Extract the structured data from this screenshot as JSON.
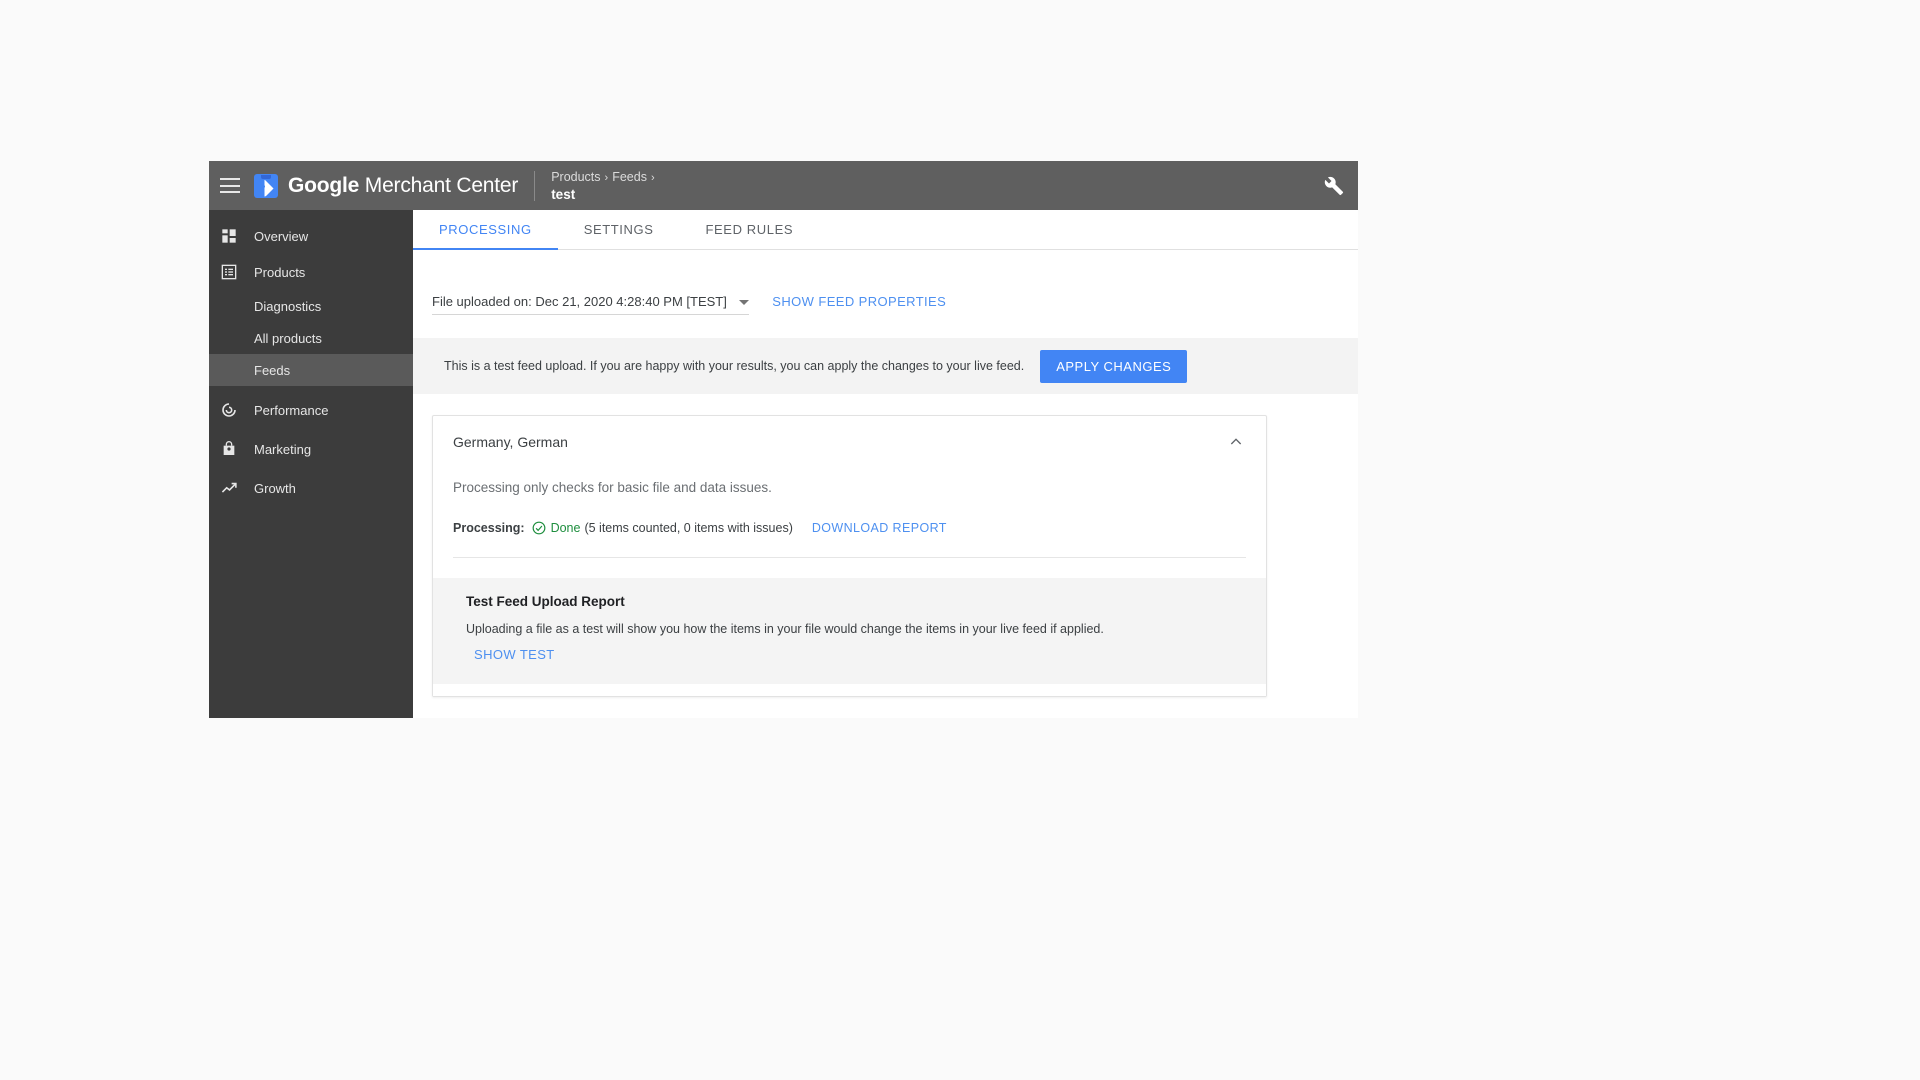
{
  "app": {
    "brand_bold": "Google",
    "brand_light": " Merchant Center",
    "logo_icon": "merchant-tag-icon",
    "menu_icon": "hamburger-menu-icon",
    "tools_icon": "wrench-icon"
  },
  "breadcrumb": {
    "items": [
      "Products",
      "Feeds"
    ],
    "separator": "›",
    "current": "test"
  },
  "sidebar": {
    "items": [
      {
        "label": "Overview",
        "icon": "dashboard-icon",
        "type": "top",
        "active": false
      },
      {
        "label": "Products",
        "icon": "products-list-icon",
        "type": "top",
        "active": false
      },
      {
        "label": "Diagnostics",
        "icon": "",
        "type": "sub",
        "active": false
      },
      {
        "label": "All products",
        "icon": "",
        "type": "sub",
        "active": false
      },
      {
        "label": "Feeds",
        "icon": "",
        "type": "sub",
        "active": true
      },
      {
        "label": "Performance",
        "icon": "performance-circle-icon",
        "type": "top",
        "active": false
      },
      {
        "label": "Marketing",
        "icon": "shopping-bag-icon",
        "type": "top",
        "active": false
      },
      {
        "label": "Growth",
        "icon": "trending-up-icon",
        "type": "top",
        "active": false
      }
    ]
  },
  "tabs": [
    {
      "label": "PROCESSING",
      "active": true
    },
    {
      "label": "SETTINGS",
      "active": false
    },
    {
      "label": "FEED RULES",
      "active": false
    }
  ],
  "main": {
    "upload_label": "File uploaded on: Dec 21, 2020 4:28:40 PM [TEST]",
    "upload_caret_icon": "chevron-down-icon",
    "show_feed_properties": "SHOW FEED PROPERTIES",
    "notice_text": "This is a test feed upload. If you are happy with your results, you can apply the changes to your live feed.",
    "apply_button": "APPLY CHANGES"
  },
  "card": {
    "title": "Germany, German",
    "collapse_icon": "chevron-up-icon",
    "description": "Processing only checks for basic file and data issues.",
    "status_label": "Processing:",
    "status_icon": "check-circle-icon",
    "status_value": "Done",
    "status_detail": "(5 items counted, 0 items with issues)",
    "download_report": "DOWNLOAD REPORT",
    "report_title": "Test Feed Upload Report",
    "report_desc": "Uploading a file as a test will show you how the items in your file would change the items in your live feed if applied.",
    "show_test": "SHOW TEST"
  },
  "colors": {
    "accent_blue": "#4285f4",
    "link_blue": "#4e90f0",
    "success_green": "#1e8e3e",
    "topbar_gray": "#5f5f5f",
    "sidebar_gray": "#3c3c3c",
    "sidebar_active": "#5a5a5a"
  }
}
